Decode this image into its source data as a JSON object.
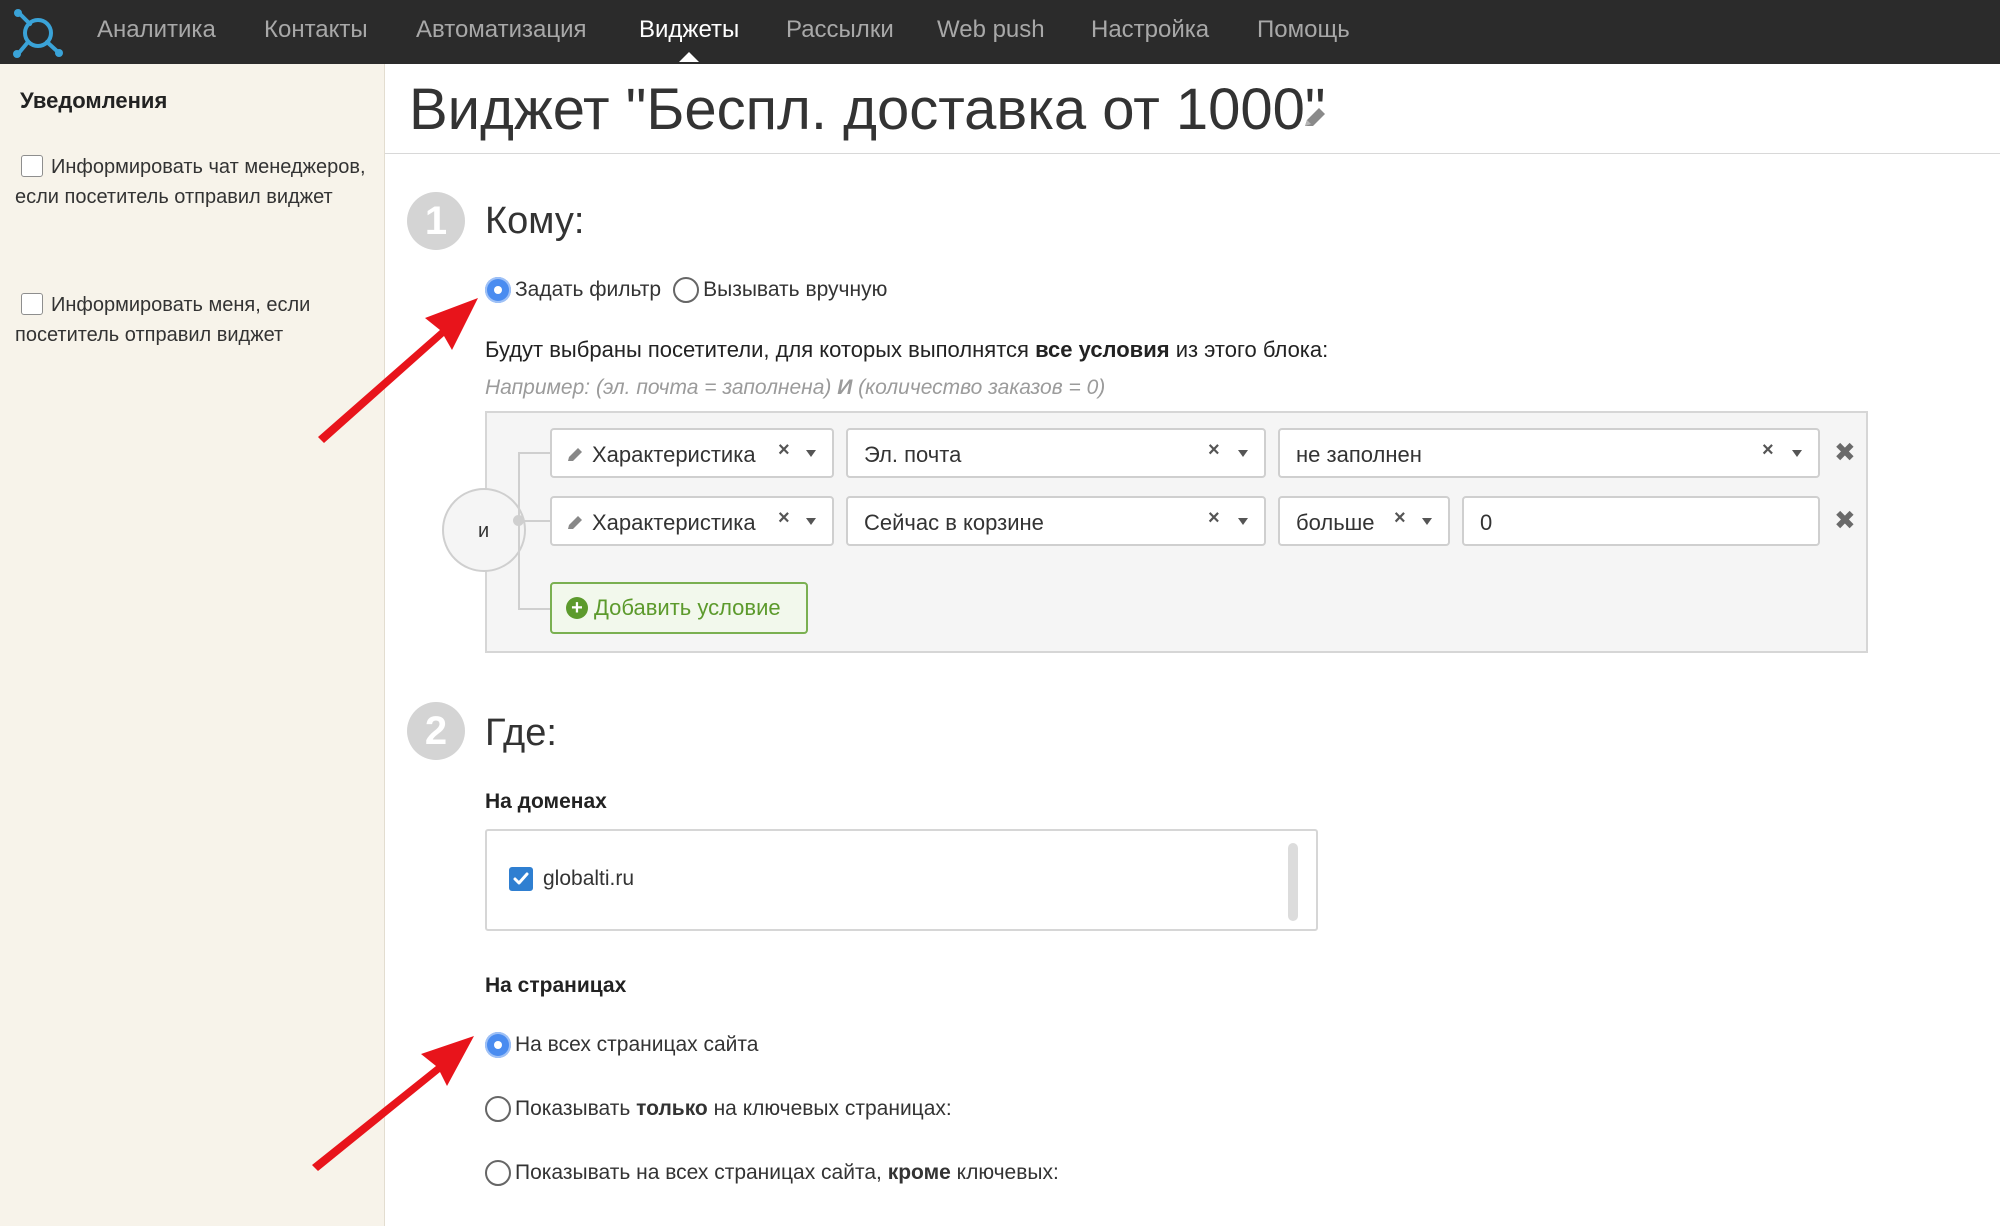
{
  "nav": {
    "items": [
      {
        "label": "Аналитика",
        "active": false
      },
      {
        "label": "Контакты",
        "active": false
      },
      {
        "label": "Автоматизация",
        "active": false
      },
      {
        "label": "Виджеты",
        "active": true
      },
      {
        "label": "Рассылки",
        "active": false
      },
      {
        "label": "Web push",
        "active": false
      },
      {
        "label": "Настройка",
        "active": false
      },
      {
        "label": "Помощь",
        "active": false
      }
    ]
  },
  "sidebar": {
    "title": "Уведомления",
    "checks": [
      {
        "label": "Информировать чат менеджеров, если посетитель отправил виджет",
        "checked": false
      },
      {
        "label": "Информировать меня, если посетитель отправил виджет",
        "checked": false
      }
    ]
  },
  "page": {
    "title": "Виджет \"Беспл. доставка от 1000\""
  },
  "step1": {
    "number": "1",
    "title": "Кому:",
    "radio_filter": "Задать фильтр",
    "radio_manual": "Вызывать вручную",
    "selected": "filter",
    "desc_pre": "Будут выбраны посетители, для которых выполнятся ",
    "desc_bold": "все условия",
    "desc_post": " из этого блока:",
    "hint_pre": "Например: (эл. почта = заполнена) ",
    "hint_bold": "И",
    "hint_post": " (количество заказов = 0)",
    "and_label": "и",
    "conditions": [
      {
        "type": "Характеристика",
        "field": "Эл. почта",
        "operator": "не заполнен",
        "value": ""
      },
      {
        "type": "Характеристика",
        "field": "Сейчас в корзине",
        "operator": "больше",
        "value": "0"
      }
    ],
    "add_condition": "Добавить условие"
  },
  "step2": {
    "number": "2",
    "title": "Где:",
    "domains_label": "На доменах",
    "domains": [
      {
        "name": "globalti.ru",
        "checked": true
      }
    ],
    "pages_label": "На страницах",
    "page_opt1": "На всех страницах сайта",
    "page_opt2_pre": "Показывать ",
    "page_opt2_bold": "только",
    "page_opt2_post": " на ключевых страницах:",
    "page_opt3_pre": "Показывать на всех страницах сайта, ",
    "page_opt3_bold": "кроме",
    "page_opt3_post": " ключевых:",
    "selected": "all"
  },
  "colors": {
    "nav_bg": "#2b2b2b",
    "sidebar_bg": "#f7f3ea",
    "radio_on": "#4a8cf0",
    "add_green": "#5c9a2c",
    "annotation_red": "#e8141b"
  },
  "icons": [
    "logo-icon",
    "pencil-icon",
    "clear-icon",
    "dropdown-arrow-icon",
    "remove-row-icon",
    "plus-circle-icon",
    "checkmark-icon",
    "red-arrow-annotation"
  ]
}
